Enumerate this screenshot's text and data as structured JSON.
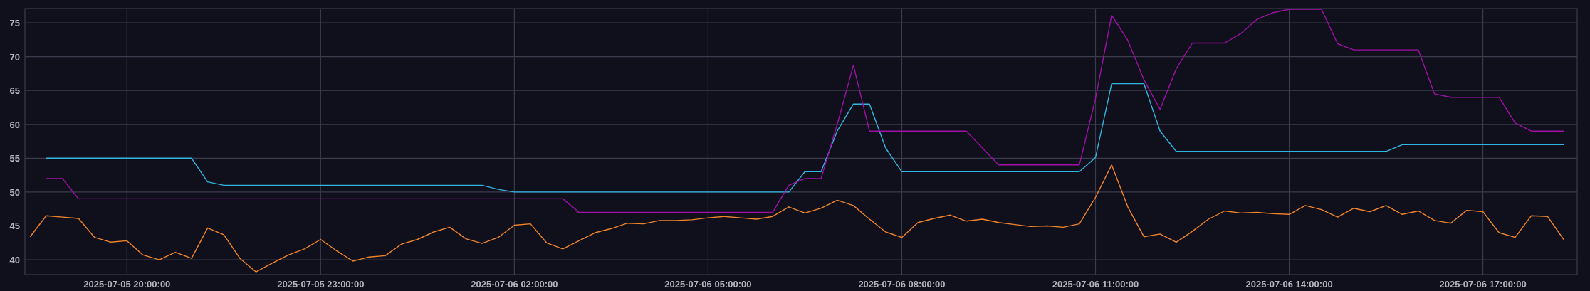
{
  "chart": {
    "chart_data": {
      "type": "line",
      "grid": true,
      "ylim": [
        37.8,
        77.1
      ],
      "categories": [
        null,
        null,
        null,
        null,
        null,
        null,
        "2025-07-05 20:00:00",
        null,
        null,
        null,
        null,
        null,
        null,
        null,
        null,
        null,
        null,
        null,
        "2025-07-05 23:00:00",
        null,
        null,
        null,
        null,
        null,
        null,
        null,
        null,
        null,
        null,
        null,
        "2025-07-06 02:00:00",
        null,
        null,
        null,
        null,
        null,
        null,
        null,
        null,
        null,
        null,
        null,
        "2025-07-06 05:00:00",
        null,
        null,
        null,
        null,
        null,
        null,
        null,
        null,
        null,
        null,
        null,
        "2025-07-06 08:00:00",
        null,
        null,
        null,
        null,
        null,
        null,
        null,
        null,
        null,
        null,
        null,
        "2025-07-06 11:00:00",
        null,
        null,
        null,
        null,
        null,
        null,
        null,
        null,
        null,
        null,
        null,
        "2025-07-06 14:00:00",
        null,
        null,
        null,
        null,
        null,
        null,
        null,
        null,
        null,
        null,
        null,
        "2025-07-06 17:00:00",
        null,
        null,
        null,
        null,
        null
      ],
      "yticks": [
        40,
        45,
        50,
        55,
        60,
        65,
        70,
        75
      ],
      "series": [
        {
          "color": "#2fb5e0",
          "values": [
            null,
            55,
            55,
            55,
            55,
            55,
            55,
            55,
            55,
            55,
            55,
            51.5,
            51,
            51,
            51,
            51,
            51,
            51,
            51,
            51,
            51,
            51,
            51,
            51,
            51,
            51,
            51,
            51,
            51,
            50.4,
            50,
            50,
            50,
            50,
            50,
            50,
            50,
            50,
            50,
            50,
            50,
            50,
            50,
            50,
            50,
            50,
            50,
            50,
            53,
            53,
            59,
            63,
            63,
            56.5,
            53,
            53,
            53,
            53,
            53,
            53,
            53,
            53,
            53,
            53,
            53,
            53,
            55.1,
            66,
            66,
            66,
            59,
            56,
            56,
            56,
            56,
            56,
            56,
            56,
            56,
            56,
            56,
            56,
            56,
            56,
            56,
            57,
            57,
            57,
            57,
            57,
            57,
            57,
            57,
            57,
            57,
            57
          ]
        },
        {
          "color": "#a010a8",
          "values": [
            null,
            52,
            52,
            49,
            49,
            49,
            49,
            49,
            49,
            49,
            49,
            49,
            49,
            49,
            49,
            49,
            49,
            49,
            49,
            49,
            49,
            49,
            49,
            49,
            49,
            49,
            49,
            49,
            49,
            49,
            49,
            49,
            49,
            49,
            47,
            47,
            47,
            47,
            47,
            47,
            47,
            47,
            47,
            47,
            47,
            47,
            47,
            51,
            52,
            52,
            60,
            68.7,
            59,
            59,
            59,
            59,
            59,
            59,
            59,
            56.5,
            54,
            54,
            54,
            54,
            54,
            54,
            63.8,
            76.1,
            72.4,
            66.6,
            62.2,
            68.2,
            72,
            72,
            72,
            73.4,
            75.5,
            76.5,
            77,
            77,
            77,
            71.9,
            71,
            71,
            71,
            71,
            71,
            64.5,
            64,
            64,
            64,
            64,
            60.2,
            59,
            59,
            59
          ]
        },
        {
          "color": "#f0842a",
          "values": [
            43.4,
            46.5,
            46.3,
            46.1,
            43.3,
            42.6,
            42.8,
            40.7,
            40.0,
            41.1,
            40.2,
            44.7,
            43.7,
            40.2,
            38.2,
            39.5,
            40.7,
            41.6,
            43.0,
            41.3,
            39.8,
            40.4,
            40.6,
            42.3,
            43.0,
            44.1,
            44.8,
            43.1,
            42.4,
            43.3,
            45.1,
            45.3,
            42.5,
            41.6,
            42.8,
            44.0,
            44.6,
            45.4,
            45.3,
            45.8,
            45.8,
            45.9,
            46.2,
            46.4,
            46.2,
            46.0,
            46.4,
            47.8,
            46.9,
            47.6,
            48.8,
            48.0,
            46.0,
            44.1,
            43.3,
            45.5,
            46.1,
            46.6,
            45.7,
            46.0,
            45.5,
            45.2,
            44.9,
            45.0,
            44.8,
            45.3,
            49.2,
            54.0,
            47.8,
            43.4,
            43.8,
            42.6,
            44.2,
            46.0,
            47.2,
            46.9,
            47.0,
            46.8,
            46.7,
            48.0,
            47.4,
            46.3,
            47.6,
            47.1,
            48.0,
            46.7,
            47.2,
            45.8,
            45.4,
            47.3,
            47.1,
            44.0,
            43.3,
            46.5,
            46.4,
            43.0
          ]
        }
      ]
    }
  }
}
